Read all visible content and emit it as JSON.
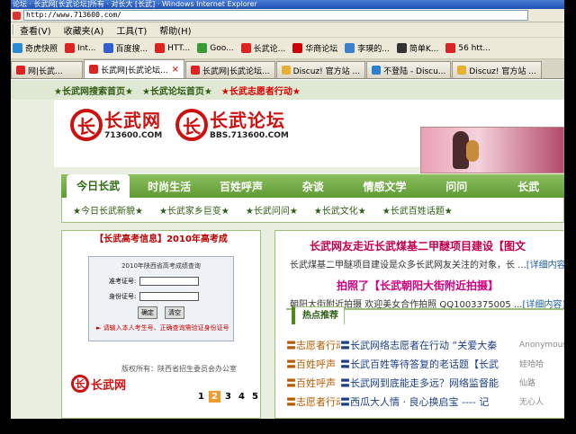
{
  "window": {
    "title": "论坛 · 长武网[长武论坛]所有 · 对长大 [长武] · Windows Internet Explorer"
  },
  "address": {
    "url": "http://www.713600.com/"
  },
  "menu": [
    "查看(V)",
    "收藏夹(A)",
    "工具(T)",
    "帮助(H)"
  ],
  "favorites": [
    {
      "label": "奇虎快照",
      "icon_color": "#2a8ad4",
      "icon": "magnifier-icon"
    },
    {
      "label": "Int...",
      "icon_color": "#d22",
      "icon": "site-icon"
    },
    {
      "label": "百度搜...",
      "icon_color": "#2f5fd0",
      "icon": "paw-icon"
    },
    {
      "label": "HTT...",
      "icon_color": "#d22",
      "icon": "site-icon"
    },
    {
      "label": "Goo...",
      "icon_color": "#3a9a3a",
      "icon": "google-icon"
    },
    {
      "label": "长武论...",
      "icon_color": "#d22",
      "icon": "site-icon"
    },
    {
      "label": "华商论坛",
      "icon_color": "#c00",
      "icon": "site-icon"
    },
    {
      "label": "李瑛的...",
      "icon_color": "#3a7fd0",
      "icon": "blog-icon"
    },
    {
      "label": "简单K...",
      "icon_color": "#333",
      "icon": "site-icon"
    },
    {
      "label": "56 htt...",
      "icon_color": "#d22",
      "icon": "video-icon"
    }
  ],
  "tabs": [
    {
      "label": "网|长武...",
      "icon_color": "#d22",
      "active": false
    },
    {
      "label": "长武网|长武论坛...",
      "icon_color": "#d22",
      "active": true
    },
    {
      "label": "长武网|长武论坛...",
      "icon_color": "#d22",
      "active": false
    },
    {
      "label": "Discuz! 官方站 ...",
      "icon_color": "#e8b030",
      "active": false
    },
    {
      "label": "不登陆 - Discu...",
      "icon_color": "#2a7fd4",
      "active": false
    },
    {
      "label": "Discuz! 官方站 ...",
      "icon_color": "#e8b030",
      "active": false
    }
  ],
  "topnav": [
    {
      "label": "★长武网搜索首页★",
      "red": false
    },
    {
      "label": "★长武论坛首页★",
      "red": false
    },
    {
      "label": "★长武志愿者行动★",
      "red": true
    }
  ],
  "logo": {
    "site1_cn": "长武网",
    "site1_en": "713600.COM",
    "site2_cn": "长武论坛",
    "site2_en": "BBS.713600.COM",
    "glyph": "长"
  },
  "mainnav": [
    "今日长武",
    "时尚生活",
    "百姓呼声",
    "杂谈",
    "情感文学",
    "问问",
    "长武"
  ],
  "subnav": [
    "★今日长武新貌★",
    "★长武家乡巨变★",
    "★长武问问★",
    "★长武文化★",
    "★长武百姓话题★"
  ],
  "left": {
    "title": "【长武高考信息】2010年高考成",
    "score_title": "2010年陕西省高考成绩查询",
    "exam_label": "准考证号:",
    "id_label": "身份证号:",
    "confirm_btn": "确定",
    "clear_btn": "清空",
    "note": "► 请输入本人考生号、正确查询需验证身份证号",
    "office": "版权所有：陕西省招生委员会办公室",
    "mini_logo": "长武网",
    "pages": [
      "1",
      "2",
      "3",
      "4",
      "5"
    ],
    "current_page": "2"
  },
  "right": {
    "headline1": "长武网友走近长武煤基二甲醚项目建设【图文",
    "summary1": "长武煤基二甲醚项目建设是众多长武网友关注的对象，长 ...",
    "summary1_more": "[详细内容]",
    "headline2": "拍照了【长武朝阳大街附近拍摄】",
    "summary2": "朝阳大街附近拍摄 欢迎美女合作拍照 QQ1003375005 ...",
    "summary2_more": "[详细内容]",
    "hot_tab": "热点推荐",
    "hot": [
      {
        "cat": "〓志愿者行动",
        "title": "〓长武网络志愿者在行动 “关爱大秦",
        "author": "Anonymous"
      },
      {
        "cat": "〓百姓呼声",
        "title": "〓长武百姓等待答复的老话题【长武",
        "author": "娃哈哈"
      },
      {
        "cat": "〓百姓呼声",
        "title": "〓长武网到底能走多远？网络监督能",
        "author": "仙路"
      },
      {
        "cat": "〓志愿者行动",
        "title": "〓西瓜大人情 · 良心换启宝 ---- 记",
        "author": "无心人"
      }
    ]
  }
}
